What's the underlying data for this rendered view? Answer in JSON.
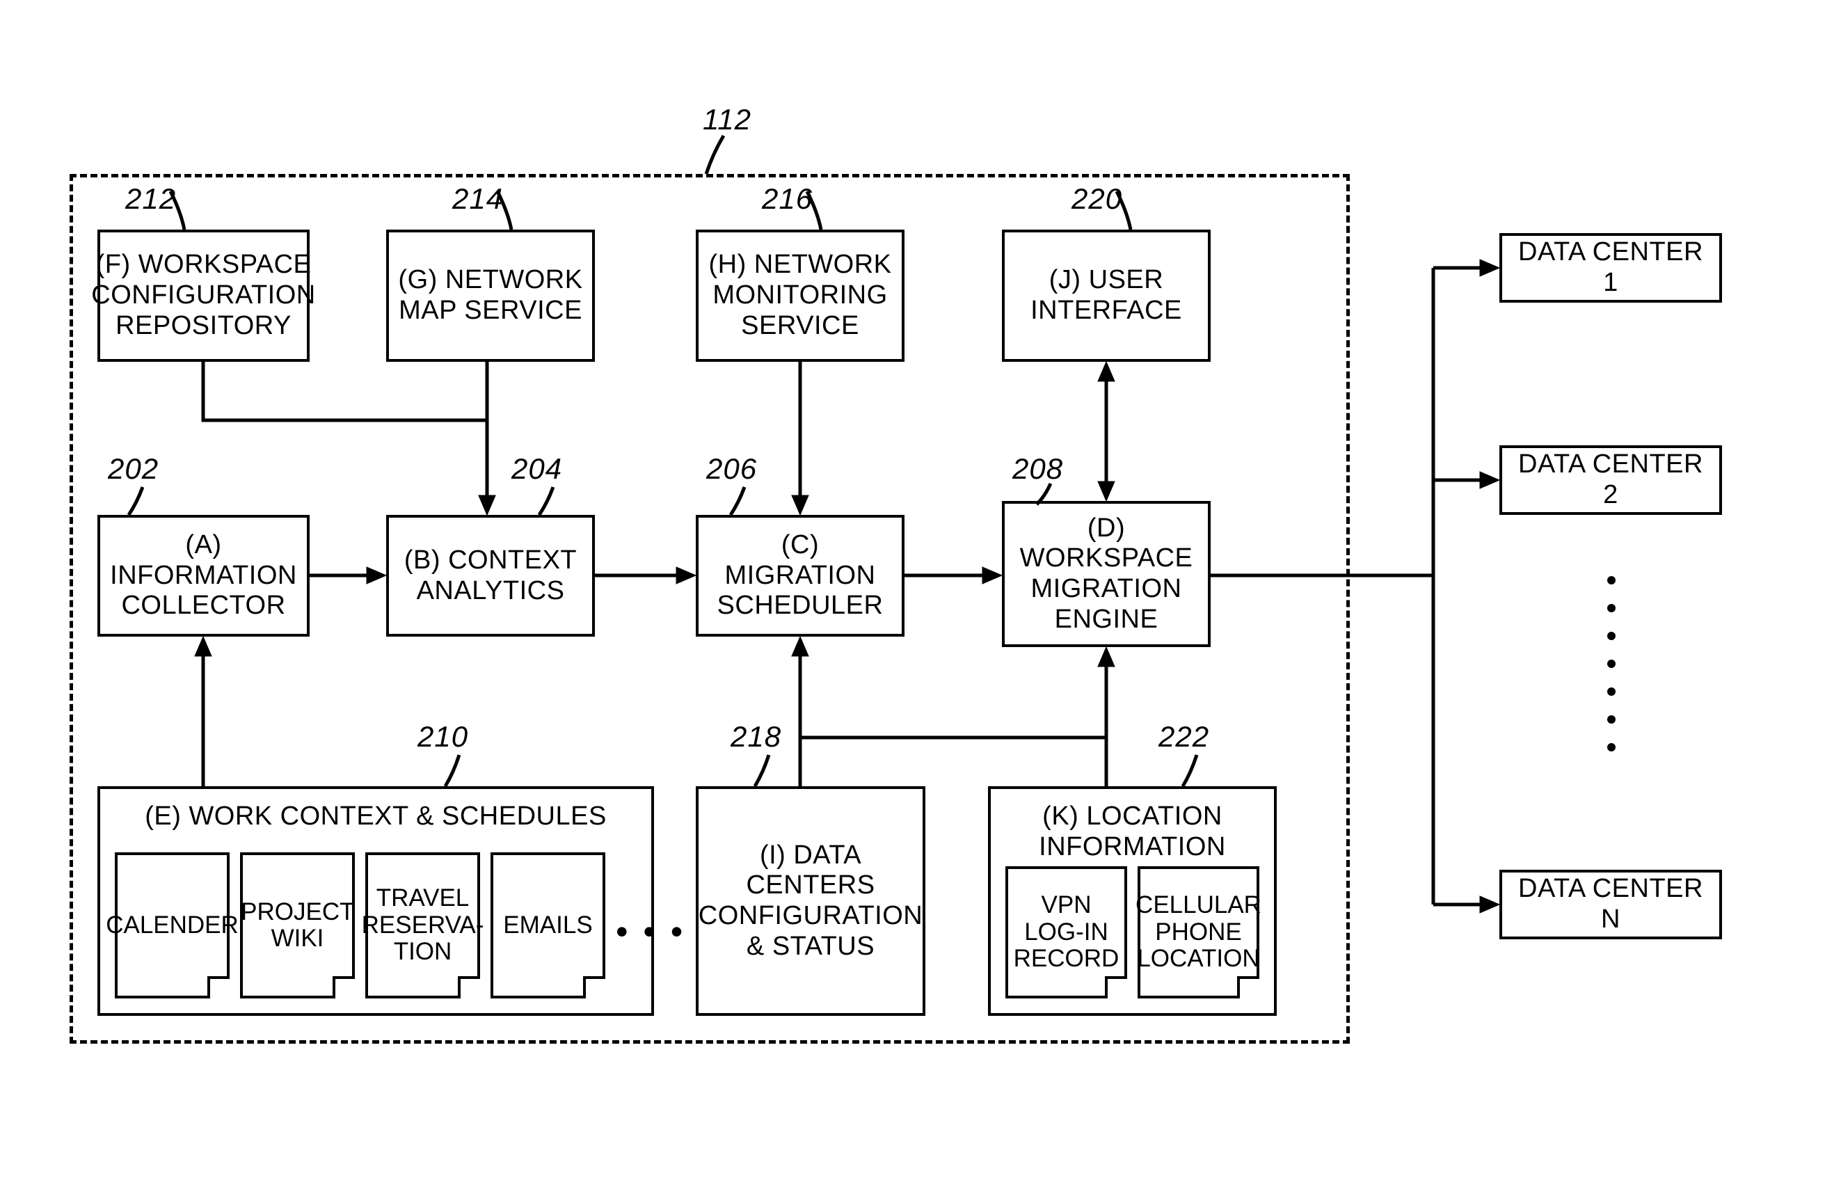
{
  "system_ref": "112",
  "blocks": {
    "A": {
      "ref": "202",
      "label": "(A) INFORMATION COLLECTOR"
    },
    "B": {
      "ref": "204",
      "label": "(B) CONTEXT ANALYTICS"
    },
    "C": {
      "ref": "206",
      "label": "(C) MIGRATION SCHEDULER"
    },
    "D": {
      "ref": "208",
      "label": "(D) WORKSPACE MIGRATION ENGINE"
    },
    "E": {
      "ref": "210",
      "label": "(E) WORK CONTEXT & SCHEDULES"
    },
    "F": {
      "ref": "212",
      "label": "(F) WORKSPACE CONFIGURATION REPOSITORY"
    },
    "G": {
      "ref": "214",
      "label": "(G) NETWORK MAP SERVICE"
    },
    "H": {
      "ref": "216",
      "label": "(H) NETWORK MONITORING SERVICE"
    },
    "I": {
      "ref": "218",
      "label": "(I) DATA CENTERS CONFIGURATION & STATUS"
    },
    "J": {
      "ref": "220",
      "label": "(J) USER INTERFACE"
    },
    "K": {
      "ref": "222",
      "label": "(K) LOCATION INFORMATION"
    }
  },
  "e_docs": {
    "calendar": "CALENDER",
    "wiki": "PROJECT WIKI",
    "travel": "TRAVEL RESERVA-TION",
    "emails": "EMAILS",
    "more": "• • •"
  },
  "k_docs": {
    "vpn": "VPN LOG-IN RECORD",
    "cell": "CELLULAR PHONE LOCATION"
  },
  "datacenters": {
    "dc1": "DATA CENTER 1",
    "dc2": "DATA CENTER 2",
    "dcn": "DATA CENTER N"
  }
}
